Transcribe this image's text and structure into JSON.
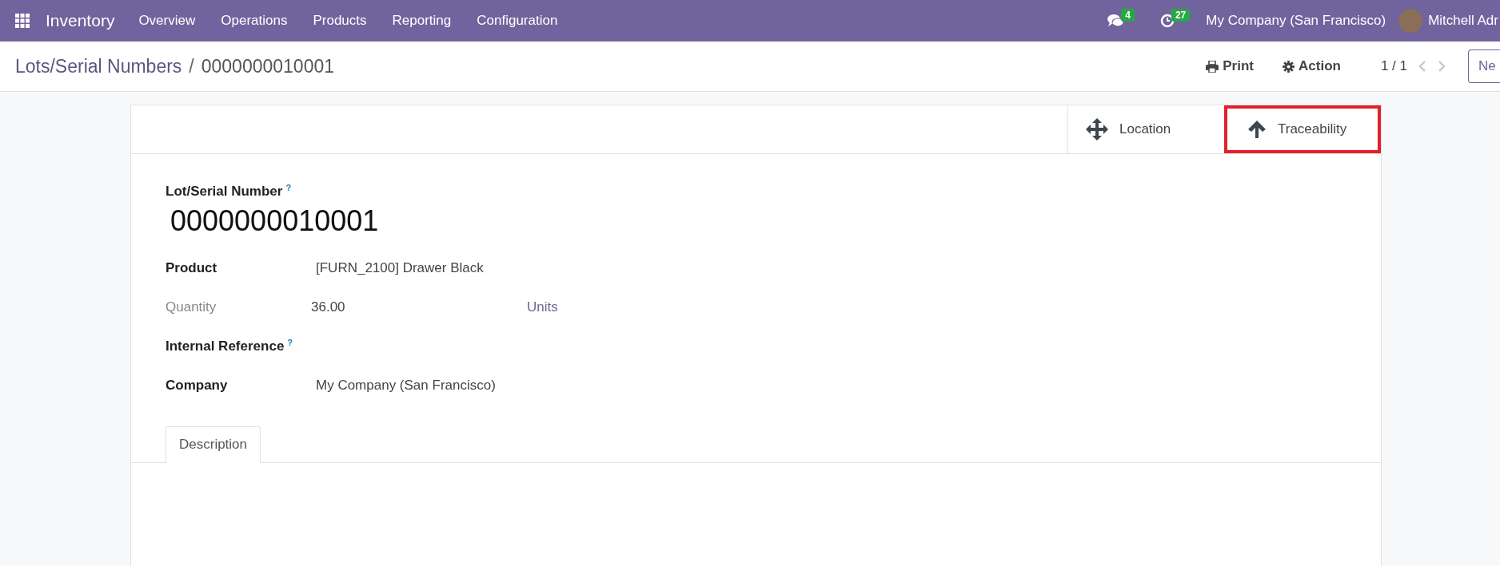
{
  "navbar": {
    "app_name": "Inventory",
    "menu": [
      "Overview",
      "Operations",
      "Products",
      "Reporting",
      "Configuration"
    ],
    "messages_count": "4",
    "activities_count": "27",
    "company": "My Company (San Francisco)",
    "user": "Mitchell Adr"
  },
  "control_panel": {
    "breadcrumb": "Lots/Serial Numbers",
    "separator": "/",
    "record": "0000000010001",
    "print": "Print",
    "action": "Action",
    "pager": "1 / 1",
    "new_button": "Ne"
  },
  "smart_buttons": [
    {
      "kind": "move",
      "label": "Location",
      "highlighted": false
    },
    {
      "kind": "up",
      "label": "Traceability",
      "highlighted": true
    }
  ],
  "form": {
    "title_label": "Lot/Serial Number",
    "title_help": "?",
    "title_value": "0000000010001",
    "fields": [
      {
        "label": "Product",
        "value": "[FURN_2100] Drawer Black",
        "muted": false
      },
      {
        "label": "Quantity",
        "value": "36.00",
        "unit": "Units",
        "muted": true
      },
      {
        "label": "Internal Reference",
        "help": "?",
        "muted": false
      },
      {
        "label": "Company",
        "value": "My Company (San Francisco)",
        "muted": false
      }
    ]
  },
  "tabs": [
    {
      "label": "Description",
      "selected": true
    }
  ]
}
